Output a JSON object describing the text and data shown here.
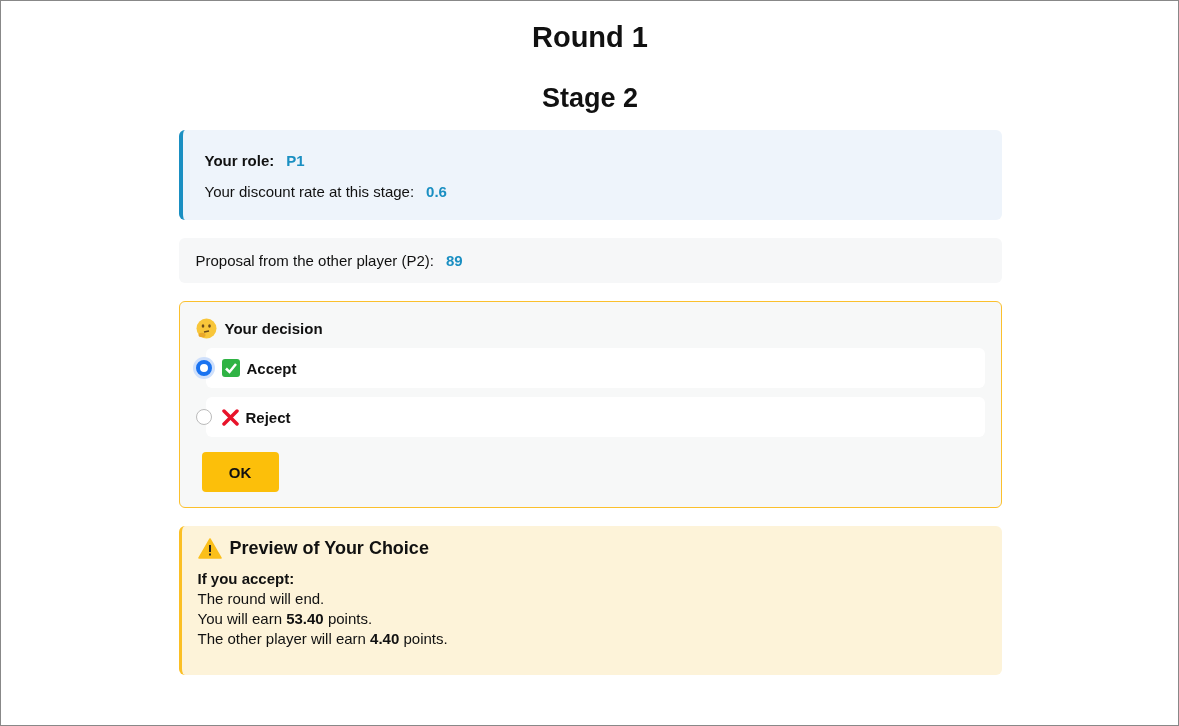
{
  "title": "Round 1",
  "subtitle": "Stage 2",
  "info": [
    {
      "label": "Your role:",
      "value": "P1",
      "bold": true
    },
    {
      "label": "Your discount rate at this stage:",
      "value": "0.6",
      "bold": false
    }
  ],
  "proposal": {
    "label": "Proposal from the other player (P2):",
    "value": "89"
  },
  "decision": {
    "title": "Your decision",
    "options": [
      {
        "label": "Accept",
        "kind": "accept",
        "selected": true
      },
      {
        "label": "Reject",
        "kind": "reject",
        "selected": false
      }
    ],
    "button": "OK"
  },
  "preview": {
    "title": "Preview of Your Choice",
    "heading": "If you accept:",
    "lines": [
      "The round will end.",
      "You will earn **53.40** points.",
      "The other player will earn **4.40** points."
    ]
  }
}
